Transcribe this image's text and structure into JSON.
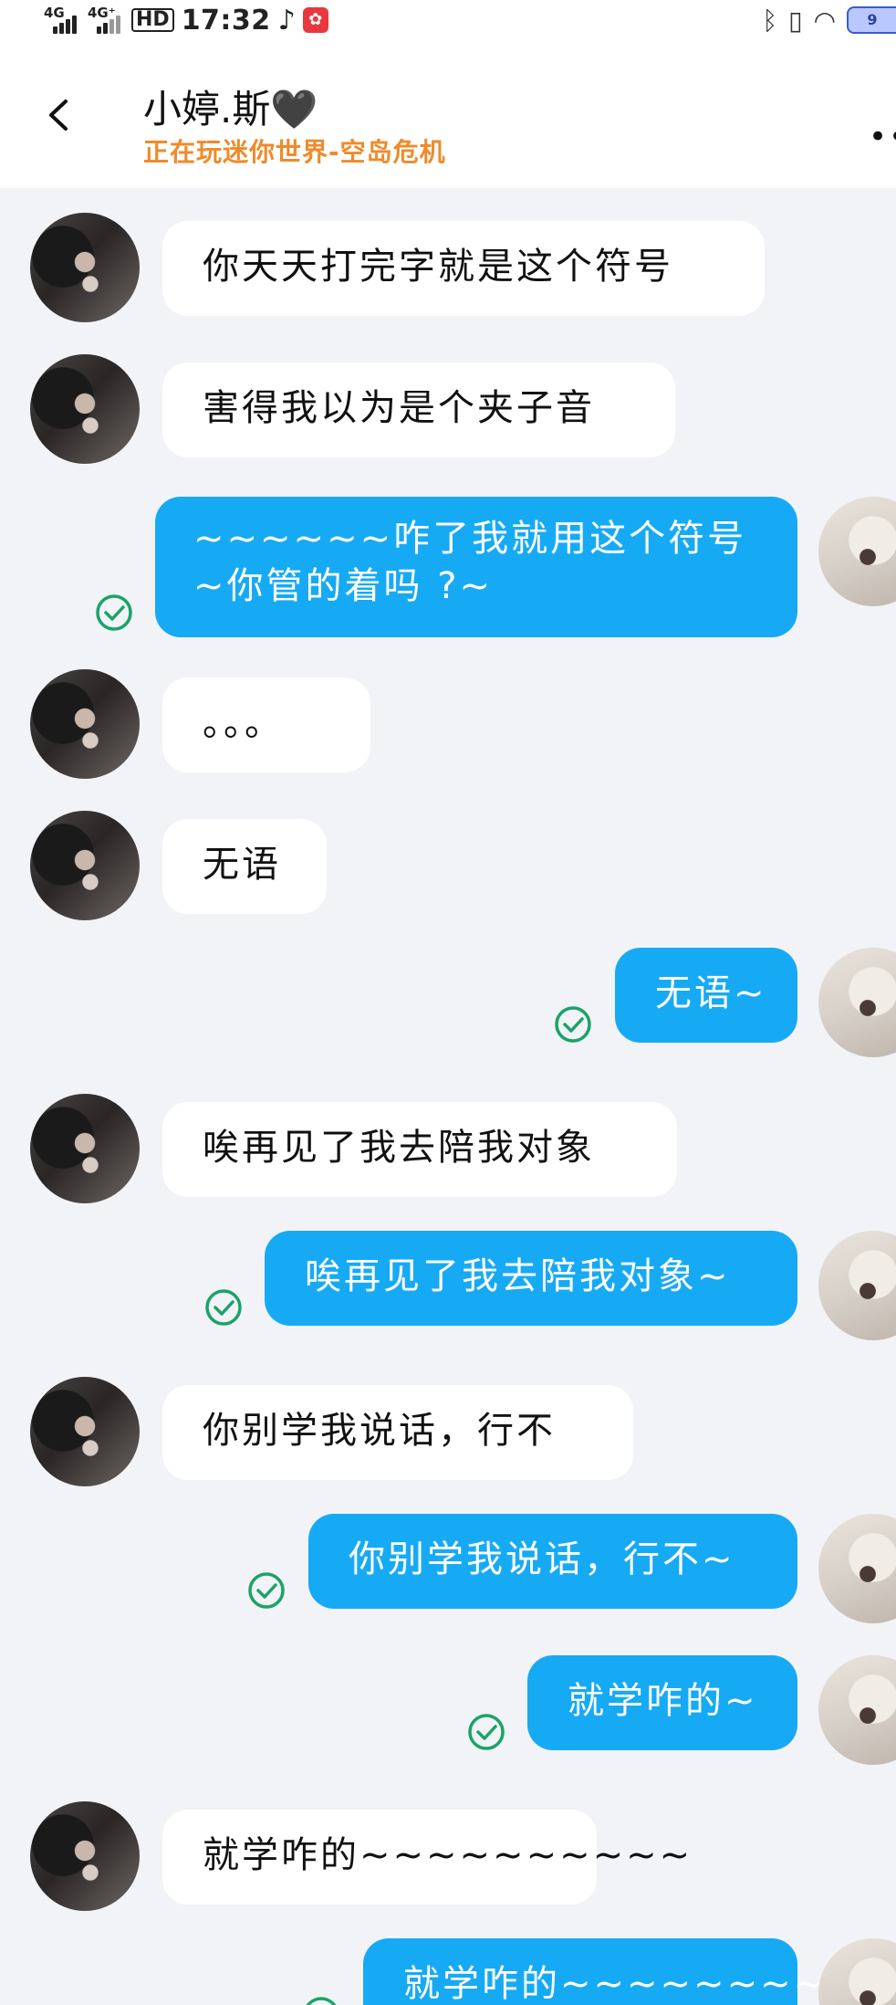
{
  "status_bar": {
    "signal_1": "4G",
    "signal_2": "4G⁺",
    "hd": "HD",
    "time": "17:32",
    "battery": "9"
  },
  "header": {
    "title": "小婷.斯🖤",
    "subtitle": "正在玩迷你世界-空岛危机",
    "more": "••"
  },
  "messages": [
    {
      "from": "them",
      "text": "你天天打完字就是这个符号"
    },
    {
      "from": "them",
      "text": "害得我以为是个夹子音"
    },
    {
      "from": "me",
      "text": "~~~~~~咋了我就用这个符号~你管的着吗 ?~",
      "read": true
    },
    {
      "from": "them",
      "text": "。。。"
    },
    {
      "from": "them",
      "text": "无语"
    },
    {
      "from": "me",
      "text": "无语~",
      "read": true
    },
    {
      "from": "them",
      "text": "唉再见了我去陪我对象"
    },
    {
      "from": "me",
      "text": "唉再见了我去陪我对象~",
      "read": true
    },
    {
      "from": "them",
      "text": "你别学我说话，行不"
    },
    {
      "from": "me",
      "text": "你别学我说话，行不~",
      "read": true
    },
    {
      "from": "me",
      "text": "就学咋的~",
      "read": true
    },
    {
      "from": "them",
      "text": "就学咋的~~~~~~~~~~"
    },
    {
      "from": "me",
      "text": "就学咋的~~~~~~~~~~",
      "read": true
    }
  ],
  "colors": {
    "outgoing_bubble": "#17aaf4",
    "incoming_bubble": "#ffffff",
    "read_check": "#1aa36a",
    "subtitle": "#f08a2a"
  }
}
